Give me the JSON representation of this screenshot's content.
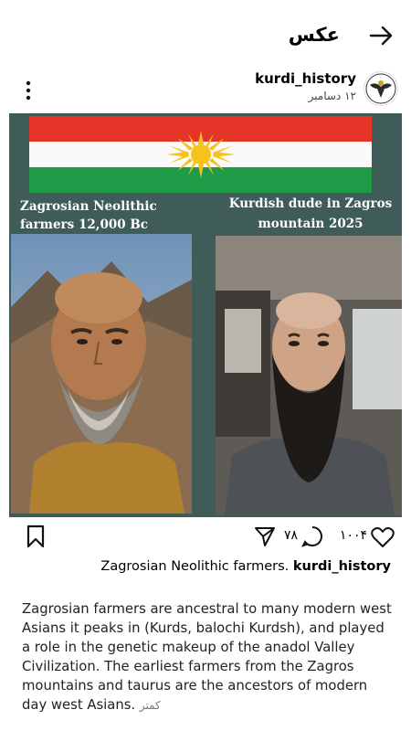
{
  "topbar": {
    "title": "عکس"
  },
  "post": {
    "username": "kurdi_history",
    "date": "۱۲ دسامبر",
    "image": {
      "caption_left": "Zagrosian Neolithic farmers 12,000 Bc",
      "caption_right": "Kurdish dude in Zagros mountain 2025",
      "flag_colors": [
        "#e53529",
        "#fafafa",
        "#1f9b48"
      ],
      "sun_color": "#f6c21c"
    },
    "likes": "۱۰۰۴",
    "comments": "۷۸",
    "caption_username": "kurdi_history",
    "caption_text": "Zagrosian Neolithic farmers.",
    "description": "Zagrosian farmers are ancestral to many modern west Asians it peaks in (Kurds, balochi Kurdsh), and played a role in the genetic makeup of the anadol Valley Civilization. The earliest farmers from the Zagros mountains and taurus are the ancestors of modern day west Asians.",
    "less_label": "کمتر"
  },
  "icons": [
    "back-arrow-icon",
    "more-vertical-icon",
    "bookmark-icon",
    "heart-icon",
    "comment-icon",
    "share-icon"
  ]
}
